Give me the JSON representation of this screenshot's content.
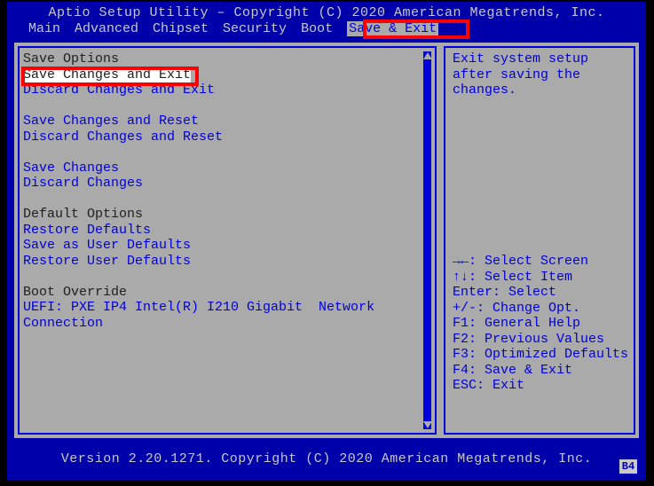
{
  "title": "Aptio Setup Utility – Copyright (C) 2020 American Megatrends, Inc.",
  "tabs": {
    "items": [
      "Main",
      "Advanced",
      "Chipset",
      "Security",
      "Boot",
      "Save & Exit"
    ],
    "active": 5
  },
  "left": {
    "g0": {
      "head": "Save Options",
      "i0": "Save Changes and Exit",
      "i1": "Discard Changes and Exit"
    },
    "g1": {
      "i0": "Save Changes and Reset",
      "i1": "Discard Changes and Reset"
    },
    "g2": {
      "i0": "Save Changes",
      "i1": "Discard Changes"
    },
    "g3": {
      "head": "Default Options",
      "i0": "Restore Defaults",
      "i1": "Save as User Defaults",
      "i2": "Restore User Defaults"
    },
    "g4": {
      "head": "Boot Override",
      "i0": "UEFI: PXE IP4 Intel(R) I210 Gigabit  Network Connection"
    }
  },
  "help": "Exit system setup after saving the changes.",
  "keys": {
    "k0": "→←: Select Screen",
    "k1": "↑↓: Select Item",
    "k2": "Enter: Select",
    "k3": "+/-: Change Opt.",
    "k4": "F1: General Help",
    "k5": "F2: Previous Values",
    "k6": "F3: Optimized Defaults",
    "k7": "F4: Save & Exit",
    "k8": "ESC: Exit"
  },
  "footer": "Version 2.20.1271. Copyright (C) 2020 American Megatrends, Inc.",
  "badge": "B4"
}
